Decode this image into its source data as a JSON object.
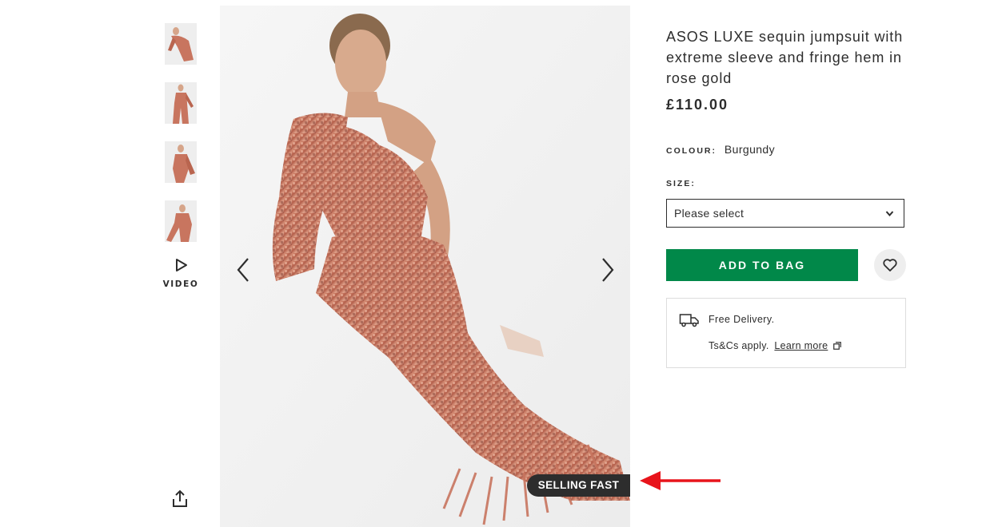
{
  "gallery": {
    "video_label": "VIDEO",
    "selling_badge": "SELLING FAST"
  },
  "product": {
    "title": "ASOS LUXE sequin jumpsuit with extreme sleeve and fringe hem in rose gold",
    "price": "£110.00",
    "colour_label": "COLOUR:",
    "colour_value": "Burgundy",
    "size_label": "SIZE:",
    "size_placeholder": "Please select",
    "add_to_bag": "ADD TO BAG"
  },
  "delivery": {
    "line1": "Free Delivery.",
    "terms": "Ts&Cs apply.",
    "learn_more": "Learn more"
  },
  "colors": {
    "accent_green": "#018849",
    "text": "#2d2d2d",
    "annotation_arrow": "#e8141b",
    "sequin": "#c8755f"
  },
  "icons": {
    "prev": "chevron-left-icon",
    "next": "chevron-right-icon",
    "play": "play-icon",
    "share": "share-icon",
    "wishlist": "heart-icon",
    "delivery": "truck-icon",
    "external": "external-link-icon",
    "dropdown": "chevron-down-icon"
  }
}
